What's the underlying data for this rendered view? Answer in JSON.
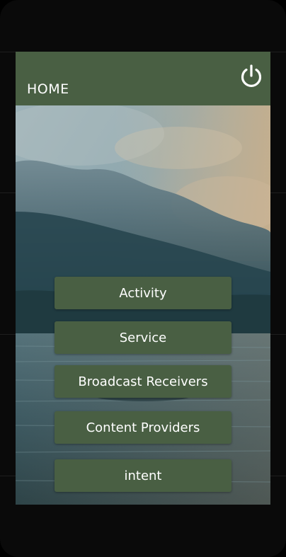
{
  "app_bar": {
    "title": "HOME",
    "power_icon": "power-icon"
  },
  "menu": {
    "activity": "Activity",
    "service": "Service",
    "broadcast": "Broadcast Receivers",
    "content": "Content Providers",
    "intent": "intent"
  },
  "colors": {
    "primary": "#495f43",
    "text_on_primary": "#ffffff"
  }
}
